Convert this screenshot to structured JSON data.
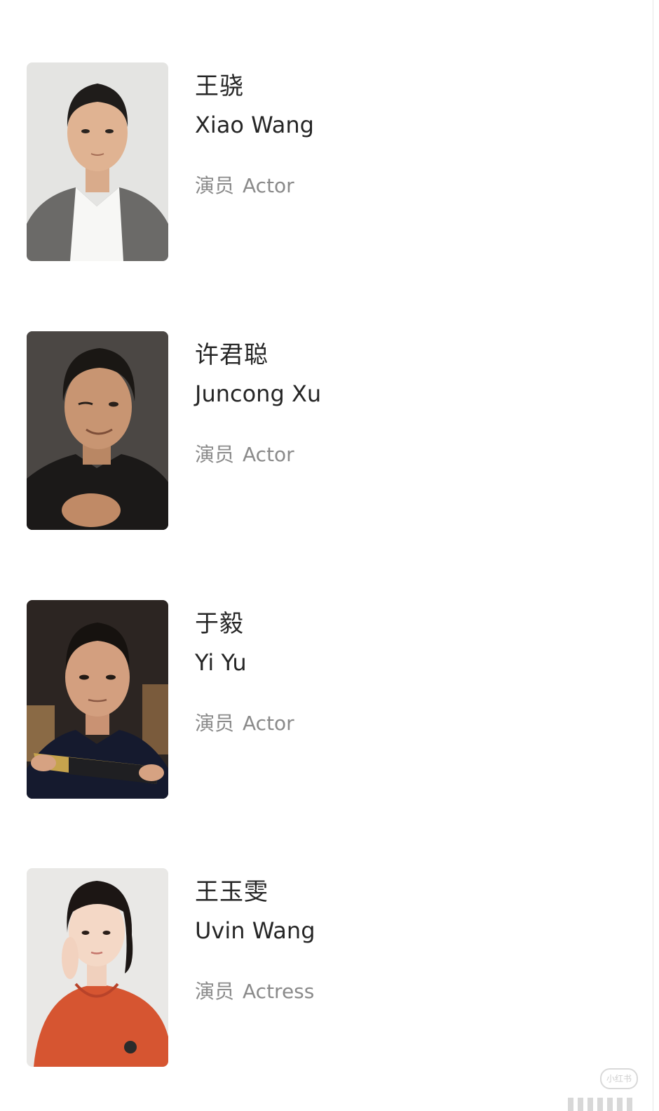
{
  "cast": [
    {
      "name_cn": "王骁",
      "name_en": "Xiao Wang",
      "role_cn": "演员",
      "role_en": "Actor",
      "photo_icon": "portrait-man-grey-suit"
    },
    {
      "name_cn": "许君聪",
      "name_en": "Juncong Xu",
      "role_cn": "演员",
      "role_en": "Actor",
      "photo_icon": "portrait-man-leather-jacket"
    },
    {
      "name_cn": "于毅",
      "name_en": "Yi Yu",
      "role_cn": "演员",
      "role_en": "Actor",
      "photo_icon": "portrait-man-holding-fan"
    },
    {
      "name_cn": "王玉雯",
      "name_en": "Uvin Wang",
      "role_cn": "演员",
      "role_en": "Actress",
      "photo_icon": "portrait-woman-red-hoodie"
    }
  ],
  "watermark": {
    "text": "小红书"
  },
  "colors": {
    "background": "#ffffff",
    "name_text": "#262626",
    "role_text": "#8a8a8a"
  }
}
